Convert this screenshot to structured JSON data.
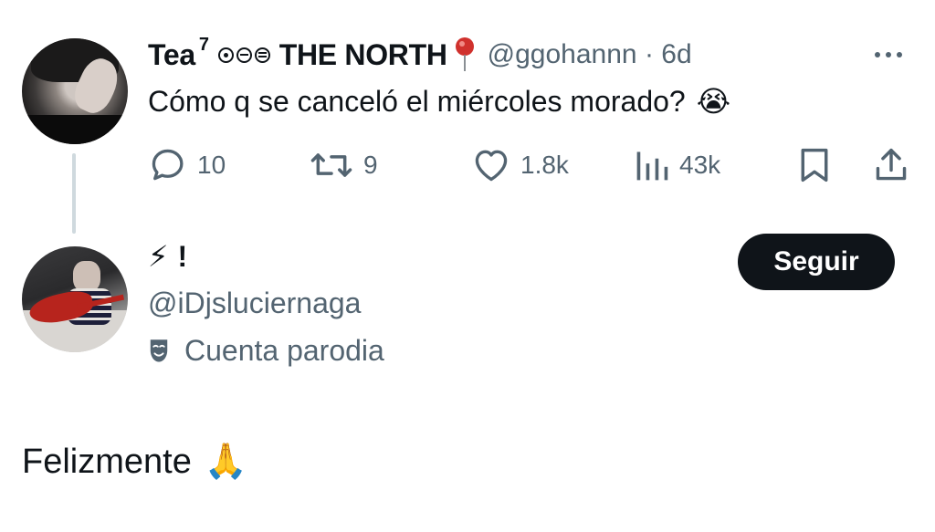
{
  "original_tweet": {
    "display_name": "Tea",
    "superscript": "7",
    "north_label": "THE NORTH",
    "handle_time": "@ggohannn · 6d",
    "text": "Cómo q se canceló el miércoles morado?",
    "emoji": "😭",
    "icons": [
      "pin-icon",
      "more-icon",
      "reply-icon",
      "retweet-icon",
      "like-icon",
      "views-icon",
      "bookmark-icon",
      "share-icon"
    ],
    "stats": {
      "replies": "10",
      "retweets": "9",
      "likes": "1.8k",
      "views": "43k"
    }
  },
  "reply_user": {
    "name_symbol": "!",
    "name_emoji": "⚡",
    "handle": "@iDjsluciernaga",
    "parody_label": "Cuenta parodia",
    "follow_label": "Seguir"
  },
  "reply": {
    "text": "Felizmente",
    "emoji": "🙏"
  },
  "colors": {
    "text_primary": "#0f1419",
    "text_secondary": "#536471",
    "thread_line": "#cfd9de",
    "button_bg": "#0f1419",
    "button_text": "#ffffff",
    "pin_red": "#d0312d"
  }
}
